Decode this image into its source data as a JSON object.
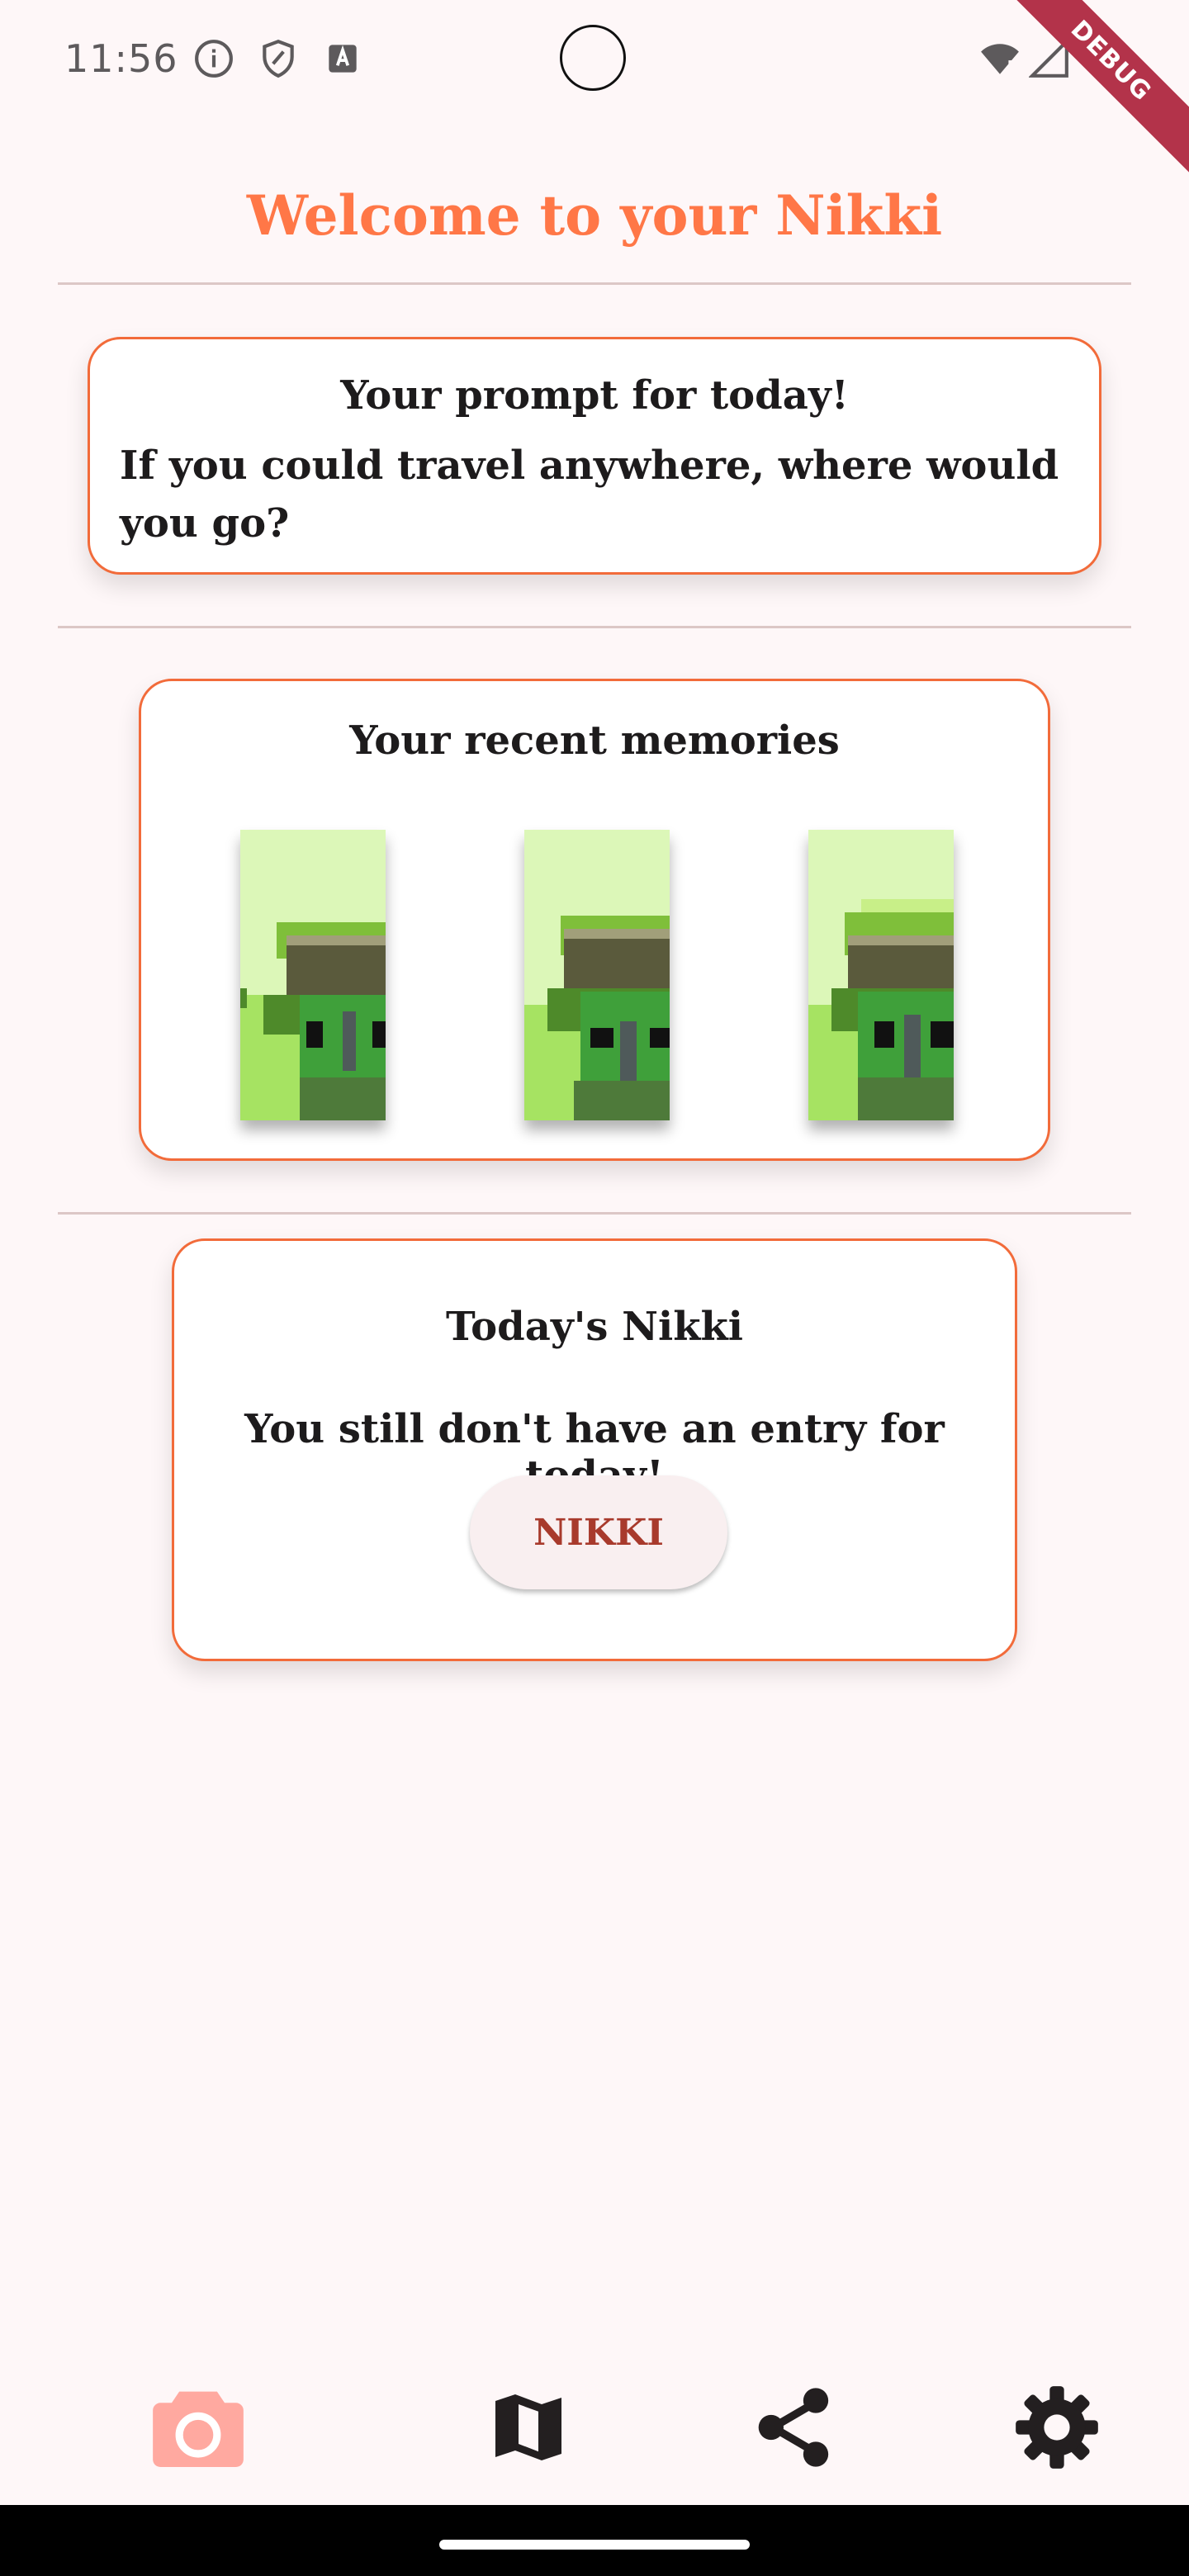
{
  "status_bar": {
    "time": "11:56",
    "icons": [
      "info-icon",
      "shield-icon",
      "text-icon",
      "wifi-icon",
      "signal-icon"
    ],
    "debug_label": "DEBUG"
  },
  "header": {
    "title": "Welcome to your Nikki",
    "title_color": "#ff7747"
  },
  "prompt_card": {
    "heading": "Your prompt for today!",
    "text": "If you could travel anywhere, where would you go?"
  },
  "memories_card": {
    "heading": "Your recent memories",
    "items": [
      "memory-thumbnail",
      "memory-thumbnail",
      "memory-thumbnail"
    ]
  },
  "today_card": {
    "heading": "Today's Nikki",
    "message": "You still don't have an entry for today!",
    "button_label": "NIKKI"
  },
  "bottom_nav": {
    "items": [
      {
        "icon": "camera-icon",
        "active": true
      },
      {
        "icon": "map-icon",
        "active": false
      },
      {
        "icon": "share-icon",
        "active": false
      },
      {
        "icon": "settings-icon",
        "active": false
      }
    ],
    "active_color": "#ffa9a0",
    "inactive_color": "#231f20"
  },
  "colors": {
    "accent": "#f26b3a",
    "background": "#fef7f8"
  }
}
